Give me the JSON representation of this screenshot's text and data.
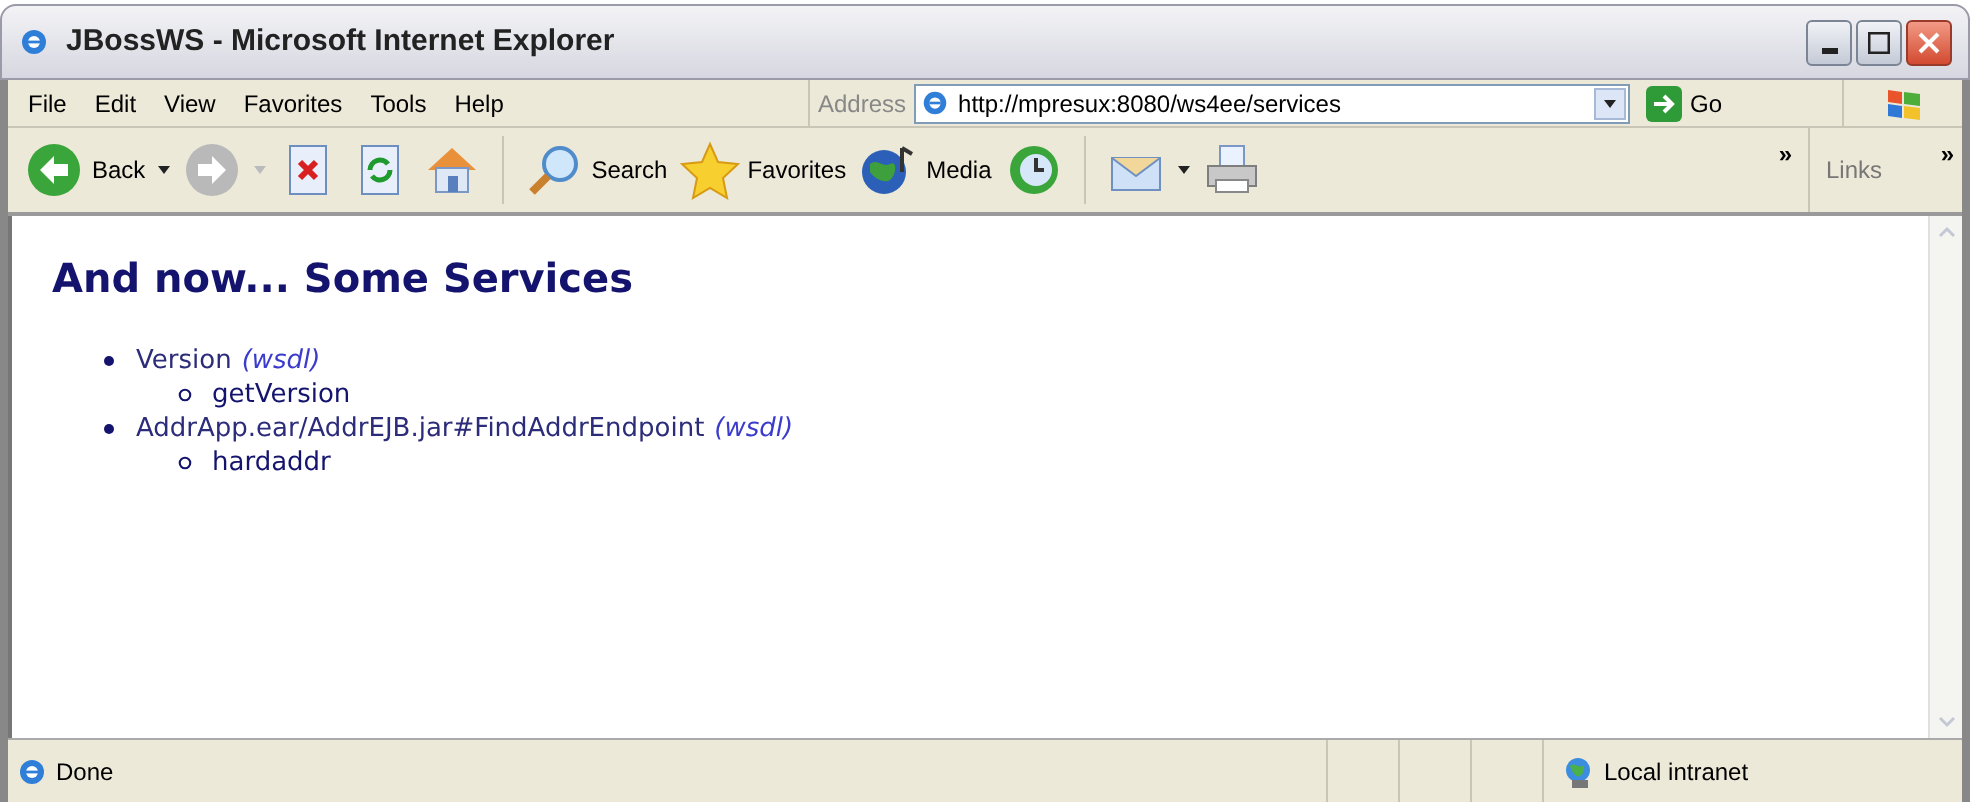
{
  "window": {
    "title": "JBossWS - Microsoft Internet Explorer"
  },
  "menu": [
    "File",
    "Edit",
    "View",
    "Favorites",
    "Tools",
    "Help"
  ],
  "address": {
    "label": "Address",
    "value": "http://mpresux:8080/ws4ee/services",
    "go": "Go"
  },
  "toolbar": [
    {
      "kind": "back",
      "label": "Back"
    },
    {
      "kind": "forward"
    },
    {
      "kind": "stop"
    },
    {
      "kind": "refresh"
    },
    {
      "kind": "home"
    },
    {
      "kind": "search",
      "label": "Search"
    },
    {
      "kind": "favorites",
      "label": "Favorites"
    },
    {
      "kind": "media",
      "label": "Media"
    },
    {
      "kind": "history"
    },
    {
      "kind": "mail"
    },
    {
      "kind": "print"
    }
  ],
  "toolbar_more": "»",
  "links": {
    "label": "Links",
    "more": "»"
  },
  "page": {
    "heading": "And now... Some Services",
    "services": [
      {
        "name": "Version",
        "wsdl": "(wsdl)",
        "operations": [
          "getVersion"
        ]
      },
      {
        "name": "AddrApp.ear/AddrEJB.jar#FindAddrEndpoint",
        "wsdl": "(wsdl)",
        "operations": [
          "hardaddr"
        ]
      }
    ]
  },
  "status_bar": {
    "text": "Done",
    "zone": "Local intranet"
  }
}
